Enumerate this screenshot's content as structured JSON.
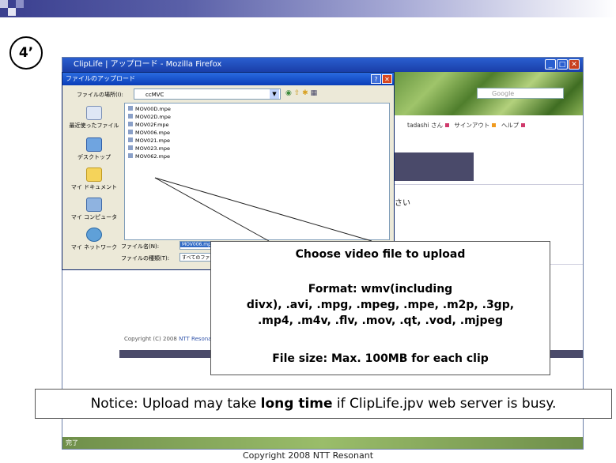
{
  "step_label": "4’",
  "browser": {
    "title": "ClipLife | アップロード - Mozilla Firefox",
    "search_placeholder": "Google",
    "user_name": "tadashi さん",
    "signout": "サインアウト",
    "help": "ヘルプ",
    "mid_text": "さい",
    "copyright_prefix": "Copyright (C) 2008",
    "copyright_link": "NTT Resonant",
    "status_text": "完了"
  },
  "dialog": {
    "title": "ファイルのアップロード",
    "lookin_label": "ファイルの場所(I):",
    "lookin_value": "ccMVC",
    "places": [
      {
        "label": "最近使ったファイル",
        "icon": "recent-icon"
      },
      {
        "label": "デスクトップ",
        "icon": "desktop-icon"
      },
      {
        "label": "マイ ドキュメント",
        "icon": "my-documents-icon"
      },
      {
        "label": "マイ コンピュータ",
        "icon": "my-computer-icon"
      },
      {
        "label": "マイ ネットワーク",
        "icon": "my-network-icon"
      }
    ],
    "files": [
      "MOV00D.mpe",
      "MOV02D.mpe",
      "MOV02F.mpe",
      "MOV006.mpe",
      "MOV021.mpe",
      "MOV023.mpe",
      "MOV062.mpe"
    ],
    "filename_label": "ファイル名(N):",
    "filename_value": "MOV006.mpe",
    "filetype_label": "ファイルの種類(T):",
    "filetype_value": "すべてのファイル"
  },
  "callout": {
    "heading": "Choose video file to upload",
    "format_line1": "Format: wmv(including",
    "format_line2": "divx), .avi, .mpg, .mpeg, .mpe, .m2p, .3gp,",
    "format_line3": ".mp4, .m4v, .flv, .mov, .qt, .vod, .mjpeg",
    "filesize": "File size: Max. 100MB for each clip"
  },
  "notice": {
    "prefix": "Notice: Upload may take ",
    "bold": "long time",
    "suffix": " if ClipLife.jpv web server is busy."
  },
  "footer": "Copyright 2008 NTT Resonant"
}
